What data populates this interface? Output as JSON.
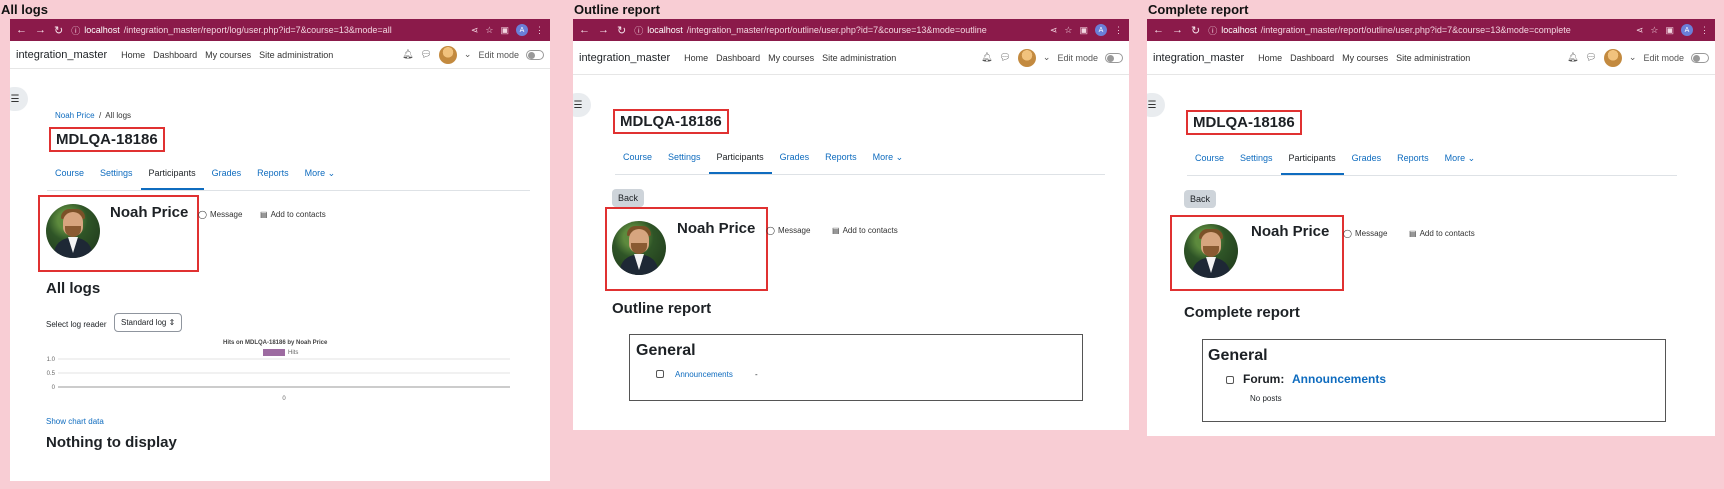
{
  "panels": [
    {
      "id": "all-logs",
      "heading": "All logs",
      "browser": {
        "url_host": "localhost",
        "url_path": "/integration_master/report/log/user.php?id=7&course=13&mode=all"
      },
      "site_name": "integration_master",
      "menu": [
        "Home",
        "Dashboard",
        "My courses",
        "Site administration"
      ],
      "edit_mode": "Edit mode",
      "breadcrumb": [
        "Noah Price",
        "All logs"
      ],
      "course_title": "MDLQA-18186",
      "tabs": [
        "Course",
        "Settings",
        "Participants",
        "Grades",
        "Reports",
        "More ⌄"
      ],
      "user_name": "Noah Price",
      "message": "Message",
      "add_to_contacts": "Add to contacts",
      "section_heading": "All logs",
      "log_reader_label": "Select log reader",
      "log_reader_value": "Standard log ⇕",
      "chart_title": "Hits on MDLQA-18186 by Noah Price",
      "show_chart_data": "Show chart data",
      "nothing": "Nothing to display"
    },
    {
      "id": "outline-report",
      "heading": "Outline report",
      "browser": {
        "url_host": "localhost",
        "url_path": "/integration_master/report/outline/user.php?id=7&course=13&mode=outline"
      },
      "site_name": "integration_master",
      "menu": [
        "Home",
        "Dashboard",
        "My courses",
        "Site administration"
      ],
      "edit_mode": "Edit mode",
      "course_title": "MDLQA-18186",
      "tabs": [
        "Course",
        "Settings",
        "Participants",
        "Grades",
        "Reports",
        "More ⌄"
      ],
      "back": "Back",
      "user_name": "Noah Price",
      "message": "Message",
      "add_to_contacts": "Add to contacts",
      "section_heading": "Outline report",
      "box_heading": "General",
      "activity": "Announcements",
      "activity_value": "-"
    },
    {
      "id": "complete-report",
      "heading": "Complete report",
      "browser": {
        "url_host": "localhost",
        "url_path": "/integration_master/report/outline/user.php?id=7&course=13&mode=complete"
      },
      "site_name": "integration_master",
      "menu": [
        "Home",
        "Dashboard",
        "My courses",
        "Site administration"
      ],
      "edit_mode": "Edit mode",
      "course_title": "MDLQA-18186",
      "tabs": [
        "Course",
        "Settings",
        "Participants",
        "Grades",
        "Reports",
        "More ⌄"
      ],
      "back": "Back",
      "user_name": "Noah Price",
      "message": "Message",
      "add_to_contacts": "Add to contacts",
      "section_heading": "Complete report",
      "box_heading": "General",
      "forum_prefix": "Forum:",
      "forum_name": "Announcements",
      "no_posts": "No posts"
    }
  ],
  "chart_data": {
    "type": "bar",
    "title": "Hits on MDLQA-18186 by Noah Price",
    "categories": [
      "0"
    ],
    "series": [
      {
        "name": "Hits",
        "values": [
          0
        ]
      }
    ],
    "ylim": [
      0,
      1.0
    ],
    "yticks": [
      "1.0",
      "0.5",
      "0"
    ],
    "legend": "top",
    "series_color": "#9d6ba1"
  }
}
